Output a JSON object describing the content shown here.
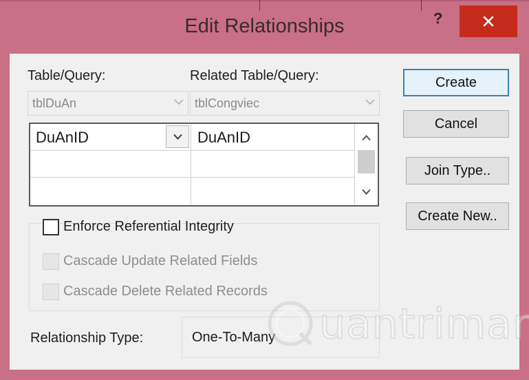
{
  "window": {
    "title": "Edit Relationships",
    "help_label": "?",
    "close_icon": "close-icon"
  },
  "tables": {
    "table_label": "Table/Query:",
    "related_label": "Related Table/Query:",
    "table_value": "tblDuAn",
    "related_value": "tblCongviec"
  },
  "fields": {
    "rows": [
      {
        "left": "DuAnID",
        "right": "DuAnID"
      },
      {
        "left": "",
        "right": ""
      },
      {
        "left": "",
        "right": ""
      }
    ]
  },
  "buttons": {
    "create": "Create",
    "cancel": "Cancel",
    "join_type": "Join Type..",
    "create_new": "Create New.."
  },
  "options": {
    "enforce": {
      "label": "Enforce Referential Integrity",
      "checked": false,
      "enabled": true
    },
    "cascade_update": {
      "label": "Cascade Update Related Fields",
      "checked": false,
      "enabled": false
    },
    "cascade_delete": {
      "label": "Cascade Delete Related Records",
      "checked": false,
      "enabled": false
    }
  },
  "relationship": {
    "label": "Relationship Type:",
    "value": "One-To-Many"
  },
  "watermark": {
    "text": "uantrimang"
  },
  "colors": {
    "frame": "#c96f86",
    "close_button": "#c42b1c",
    "default_button_border": "#3c7fb1"
  }
}
